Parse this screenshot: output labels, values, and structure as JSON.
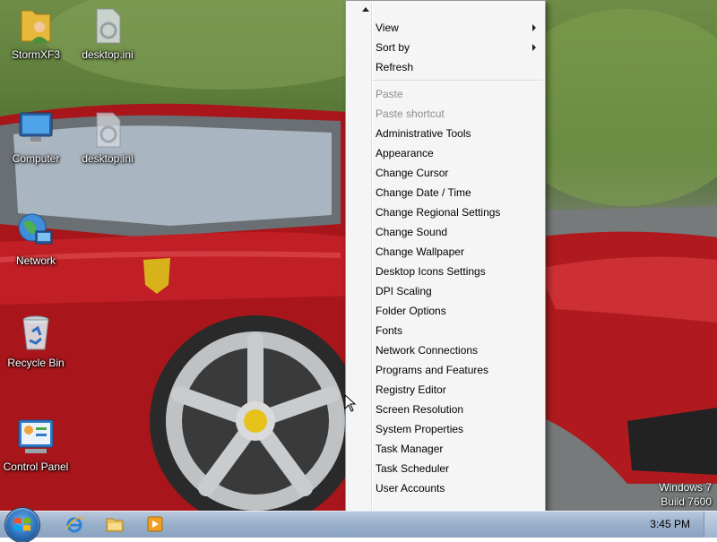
{
  "desktop": {
    "icons": [
      {
        "label": "StormXF3",
        "icon": "user-folder-icon"
      },
      {
        "label": "desktop.ini",
        "icon": "settings-file-icon"
      },
      {
        "label": "Computer",
        "icon": "computer-icon"
      },
      {
        "label": "desktop.ini",
        "icon": "settings-file-icon"
      },
      {
        "label": "Network",
        "icon": "network-icon"
      },
      {
        "label": "Recycle Bin",
        "icon": "recycle-bin-icon"
      },
      {
        "label": "Control Panel",
        "icon": "control-panel-icon"
      }
    ]
  },
  "context_menu": {
    "items": [
      {
        "label": "View",
        "submenu": true,
        "enabled": true
      },
      {
        "label": "Sort by",
        "submenu": true,
        "enabled": true
      },
      {
        "label": "Refresh",
        "submenu": false,
        "enabled": true
      },
      {
        "label": "Paste",
        "submenu": false,
        "enabled": false
      },
      {
        "label": "Paste shortcut",
        "submenu": false,
        "enabled": false
      },
      {
        "label": "Administrative Tools",
        "enabled": true
      },
      {
        "label": "Appearance",
        "enabled": true
      },
      {
        "label": "Change Cursor",
        "enabled": true
      },
      {
        "label": "Change Date / Time",
        "enabled": true
      },
      {
        "label": "Change Regional Settings",
        "enabled": true
      },
      {
        "label": "Change Sound",
        "enabled": true
      },
      {
        "label": "Change Wallpaper",
        "enabled": true
      },
      {
        "label": "Desktop Icons Settings",
        "enabled": true
      },
      {
        "label": "DPI Scaling",
        "enabled": true
      },
      {
        "label": "Folder Options",
        "enabled": true
      },
      {
        "label": "Fonts",
        "enabled": true
      },
      {
        "label": "Network Connections",
        "enabled": true
      },
      {
        "label": "Programs and Features",
        "enabled": true
      },
      {
        "label": "Registry Editor",
        "enabled": true
      },
      {
        "label": "Screen Resolution",
        "enabled": true
      },
      {
        "label": "System Properties",
        "enabled": true
      },
      {
        "label": "Task Manager",
        "enabled": true
      },
      {
        "label": "Task Scheduler",
        "enabled": true
      },
      {
        "label": "User Accounts",
        "enabled": true
      }
    ]
  },
  "watermark": {
    "line1": "Windows 7",
    "line2": "Build 7600"
  },
  "taskbar": {
    "pinned": [
      {
        "icon": "internet-explorer-icon"
      },
      {
        "icon": "windows-explorer-icon"
      },
      {
        "icon": "media-player-icon"
      }
    ],
    "clock": "3:45 PM"
  },
  "colors": {
    "menu_bg": "#f5f5f5",
    "disabled_text": "#8d8d8d",
    "car_red": "#b0151b",
    "taskbar": "#9bb1cb"
  }
}
